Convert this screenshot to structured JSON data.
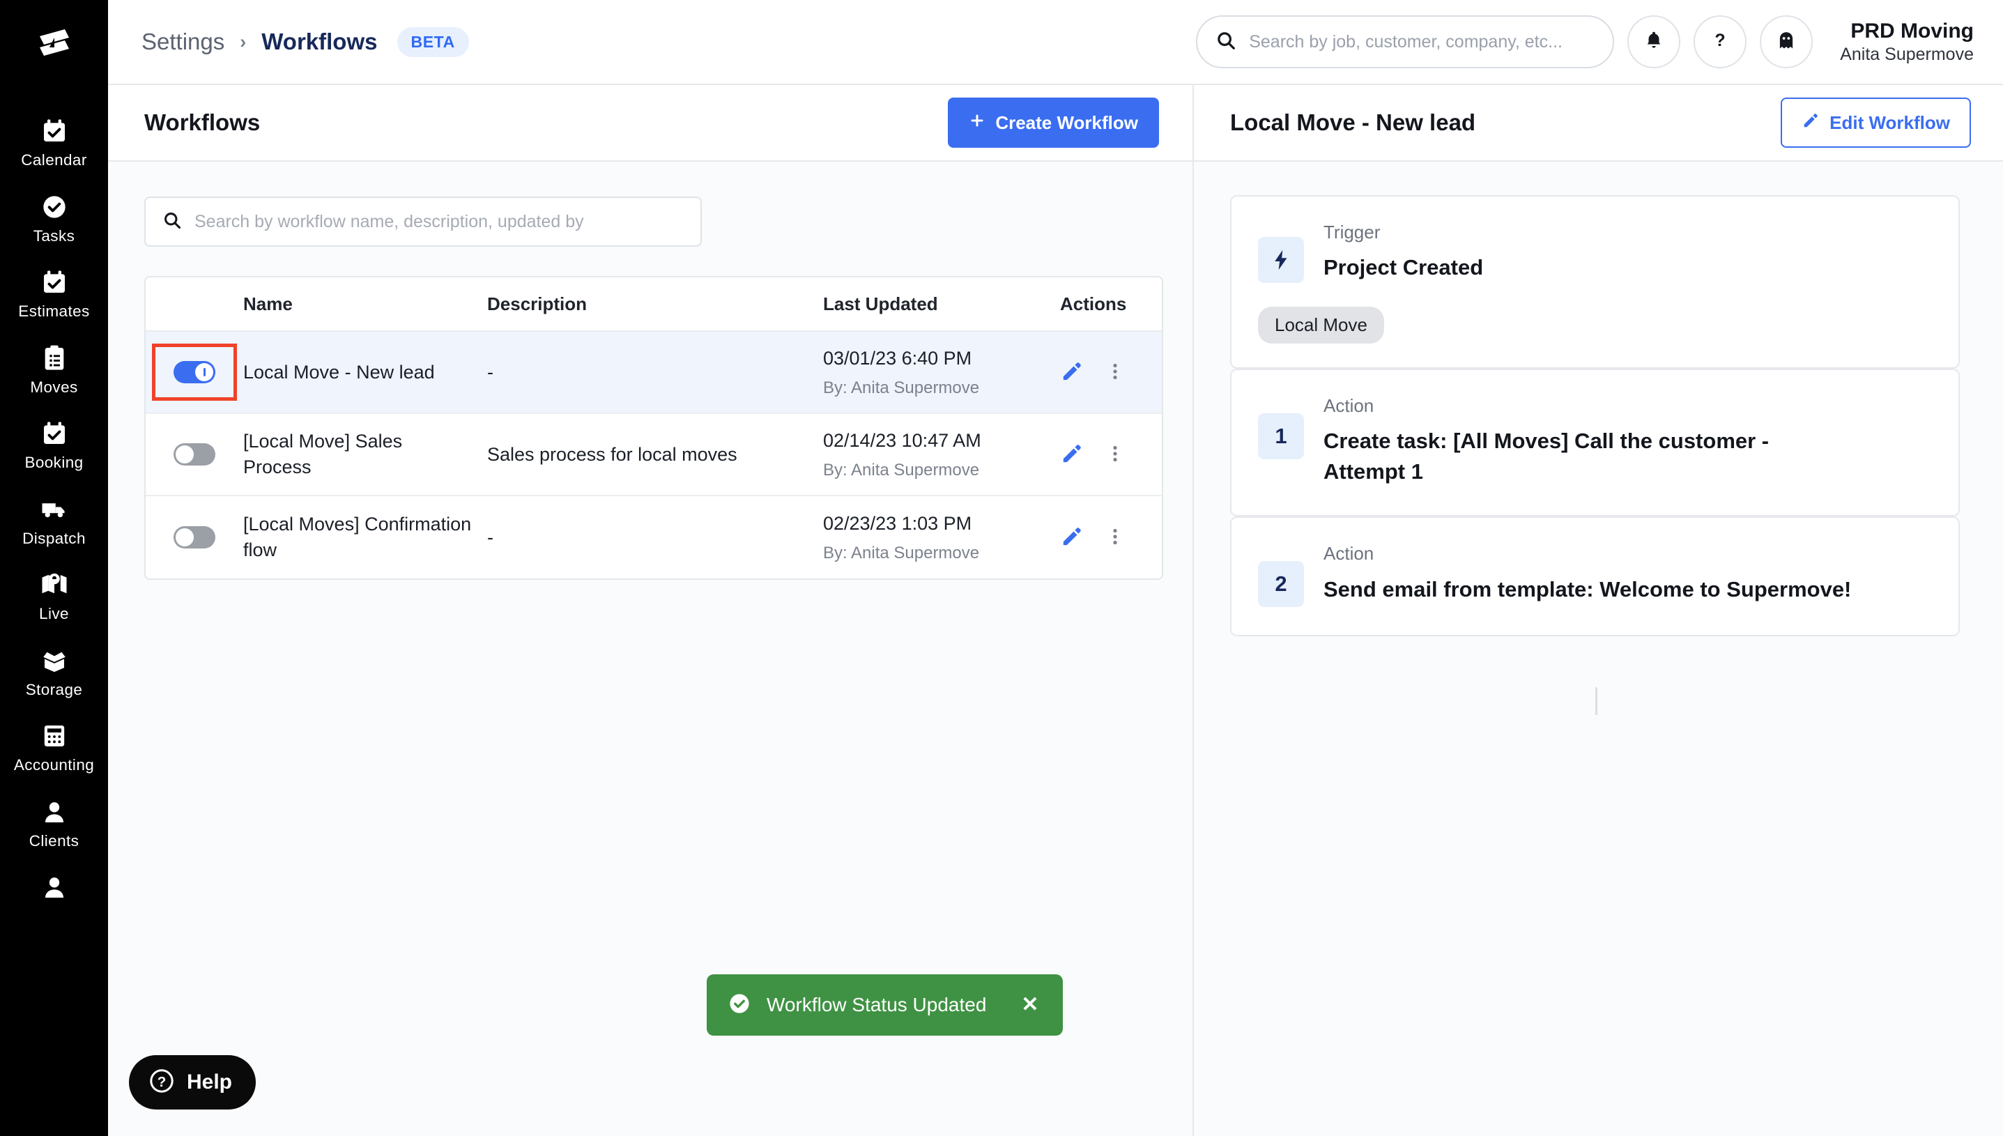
{
  "sidebar": {
    "logo_icon": "supermove-logo-icon",
    "items": [
      {
        "label": "Calendar",
        "icon": "calendar-icon"
      },
      {
        "label": "Tasks",
        "icon": "check-circle-icon"
      },
      {
        "label": "Estimates",
        "icon": "calendar-icon"
      },
      {
        "label": "Moves",
        "icon": "clipboard-list-icon"
      },
      {
        "label": "Booking",
        "icon": "calendar-icon"
      },
      {
        "label": "Dispatch",
        "icon": "truck-icon"
      },
      {
        "label": "Live",
        "icon": "map-pin-icon"
      },
      {
        "label": "Storage",
        "icon": "box-open-icon"
      },
      {
        "label": "Accounting",
        "icon": "calculator-icon"
      },
      {
        "label": "Clients",
        "icon": "user-icon"
      },
      {
        "label": "",
        "icon": "user-icon"
      }
    ]
  },
  "topbar": {
    "breadcrumb_parent": "Settings",
    "breadcrumb_separator": "›",
    "breadcrumb_current": "Workflows",
    "beta_badge": "BETA",
    "search": {
      "value": "",
      "placeholder": "Search by job, customer, company, etc..."
    },
    "icons": {
      "notifications": "bell-icon",
      "help": "question-mark-icon",
      "ghost": "ghost-icon"
    },
    "user": {
      "company": "PRD Moving",
      "name": "Anita Supermove"
    }
  },
  "workflows_panel": {
    "title": "Workflows",
    "create_button": "Create Workflow",
    "create_button_icon": "plus-icon",
    "search": {
      "value": "",
      "placeholder": "Search by workflow name, description, updated by"
    },
    "table": {
      "columns": [
        "",
        "Name",
        "Description",
        "Last Updated",
        "Actions"
      ],
      "rows": [
        {
          "enabled": true,
          "name": "Local Move - New lead",
          "description": "-",
          "updated_at": "03/01/23 6:40 PM",
          "updated_by": "By: Anita Supermove",
          "selected": true,
          "highlighted_toggle": true
        },
        {
          "enabled": false,
          "name": "[Local Move] Sales Process",
          "description": "Sales process for local moves",
          "updated_at": "02/14/23 10:47 AM",
          "updated_by": "By: Anita Supermove",
          "selected": false,
          "highlighted_toggle": false
        },
        {
          "enabled": false,
          "name": "[Local Moves] Confirmation flow",
          "description": "-",
          "updated_at": "02/23/23 1:03 PM",
          "updated_by": "By: Anita Supermove",
          "selected": false,
          "highlighted_toggle": false
        }
      ]
    }
  },
  "detail_panel": {
    "title": "Local Move - New lead",
    "edit_button": "Edit Workflow",
    "edit_button_icon": "pencil-icon",
    "steps": [
      {
        "kind": "trigger",
        "kicker": "Trigger",
        "title": "Project Created",
        "icon": "lightning-bolt-icon",
        "chip": "Local Move"
      },
      {
        "kind": "action",
        "kicker": "Action",
        "number": "1",
        "title": "Create task: [All Moves] Call the customer - Attempt 1"
      },
      {
        "kind": "action",
        "kicker": "Action",
        "number": "2",
        "title": "Send email from template: Welcome to Supermove!"
      }
    ]
  },
  "toast": {
    "icon": "check-circle-icon",
    "message": "Workflow Status Updated",
    "close_icon": "close-icon"
  },
  "help": {
    "label": "Help",
    "icon": "question-circle-icon"
  },
  "colors": {
    "accent_blue": "#3a6df0",
    "navy": "#17295a",
    "success_green": "#3f9243",
    "highlight_red": "#f0422a",
    "sidebar_black": "#000000"
  }
}
